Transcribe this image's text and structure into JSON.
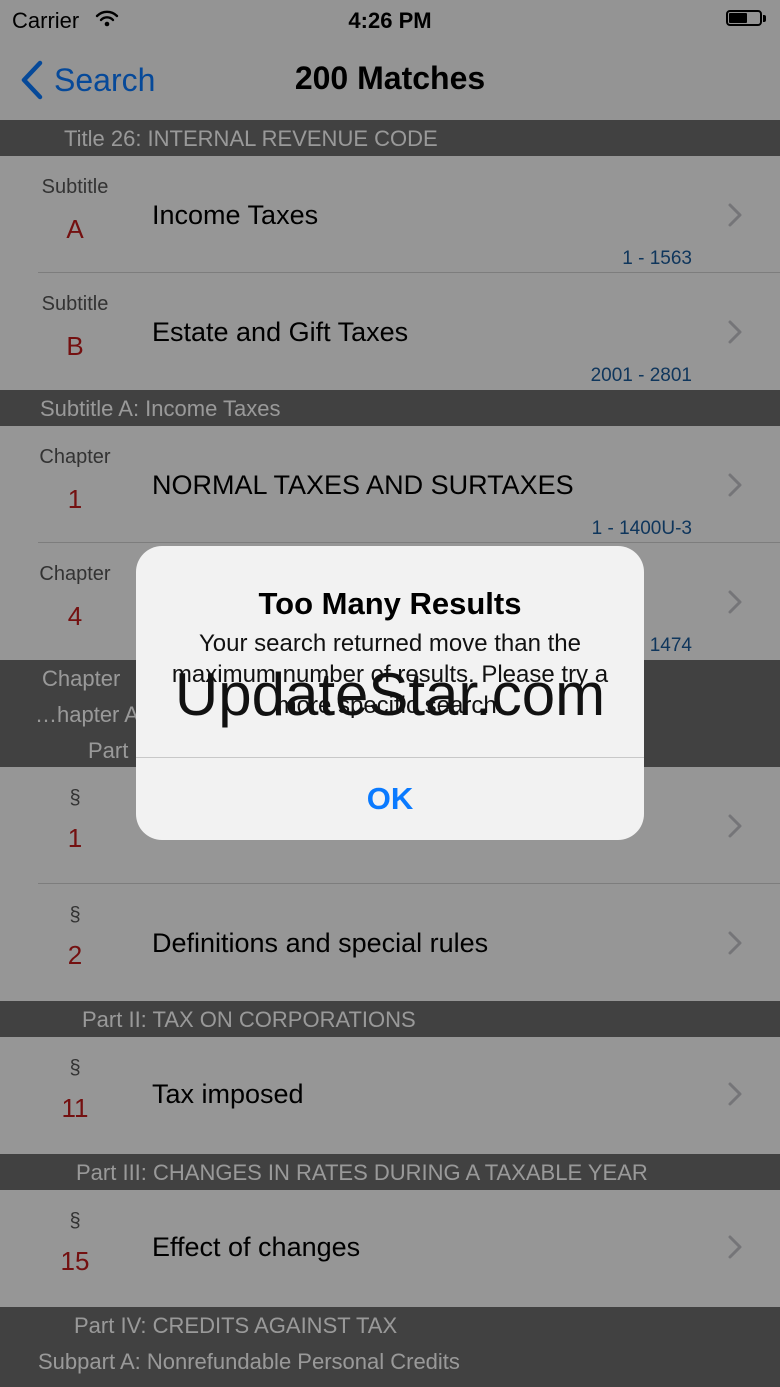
{
  "status_bar": {
    "carrier": "Carrier",
    "time": "4:26 PM"
  },
  "nav": {
    "back_label": "Search",
    "title": "200 Matches"
  },
  "sections": [
    {
      "header_lines": [
        "Title 26: INTERNAL REVENUE CODE"
      ],
      "rows": [
        {
          "kind": "Subtitle",
          "num": "A",
          "title": "Income Taxes",
          "range": "1 - 1563"
        },
        {
          "kind": "Subtitle",
          "num": "B",
          "title": "Estate and Gift Taxes",
          "range": "2001 - 2801"
        }
      ]
    },
    {
      "header_lines": [
        "Subtitle A: Income Taxes"
      ],
      "rows": [
        {
          "kind": "Chapter",
          "num": "1",
          "title": "NORMAL TAXES AND SURTAXES",
          "range": "1 - 1400U-3"
        },
        {
          "kind": "Chapter",
          "num": "4",
          "title": "",
          "range": "1474"
        }
      ]
    },
    {
      "header_lines": [
        "Chapter",
        "…hapter A",
        "Part"
      ],
      "rows": [
        {
          "kind": "§",
          "num": "1",
          "title": "",
          "range": ""
        },
        {
          "kind": "§",
          "num": "2",
          "title": "Definitions and special rules",
          "range": ""
        }
      ]
    },
    {
      "header_lines": [
        "Part II: TAX ON CORPORATIONS"
      ],
      "rows": [
        {
          "kind": "§",
          "num": "11",
          "title": "Tax imposed",
          "range": ""
        }
      ]
    },
    {
      "header_lines": [
        "Part III: CHANGES IN RATES DURING A TAXABLE YEAR"
      ],
      "rows": [
        {
          "kind": "§",
          "num": "15",
          "title": "Effect of changes",
          "range": ""
        }
      ]
    },
    {
      "header_lines": [
        "Part IV: CREDITS AGAINST TAX",
        "Subpart A: Nonrefundable Personal Credits"
      ],
      "rows": []
    }
  ],
  "alert": {
    "title": "Too Many Results",
    "message": "Your search returned move than the maximum number of results. Please try a more specific search.",
    "ok_label": "OK"
  },
  "watermark": "UpdateStar.com",
  "colors": {
    "accent": "#0a7aff",
    "number": "#c11b1b",
    "range": "#1a5a9a",
    "header_bg": "#6d6d6d"
  }
}
